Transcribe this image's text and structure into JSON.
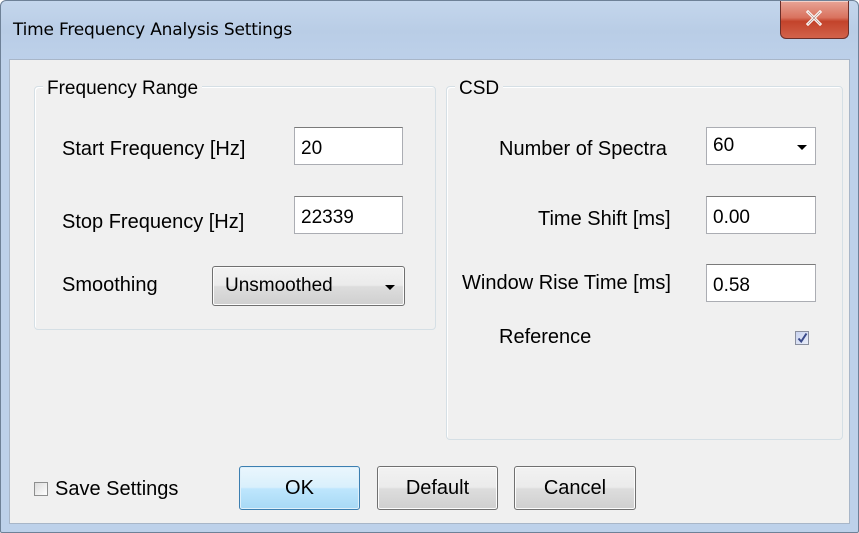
{
  "window": {
    "title": "Time Frequency Analysis Settings"
  },
  "frequency_range": {
    "title": "Frequency Range",
    "start_label": "Start Frequency [Hz]",
    "start_value": "20",
    "stop_label": "Stop Frequency [Hz]",
    "stop_value": "22339",
    "smoothing_label": "Smoothing",
    "smoothing_value": "Unsmoothed"
  },
  "csd": {
    "title": "CSD",
    "spectra_label": "Number of Spectra",
    "spectra_value": "60",
    "time_shift_label": "Time Shift [ms]",
    "time_shift_value": "0.00",
    "rise_time_label": "Window Rise Time [ms]",
    "rise_time_value": "0.58",
    "reference_label": "Reference",
    "reference_checked": true
  },
  "footer": {
    "save_settings_label": "Save Settings",
    "save_settings_checked": false,
    "ok_label": "OK",
    "default_label": "Default",
    "cancel_label": "Cancel"
  }
}
